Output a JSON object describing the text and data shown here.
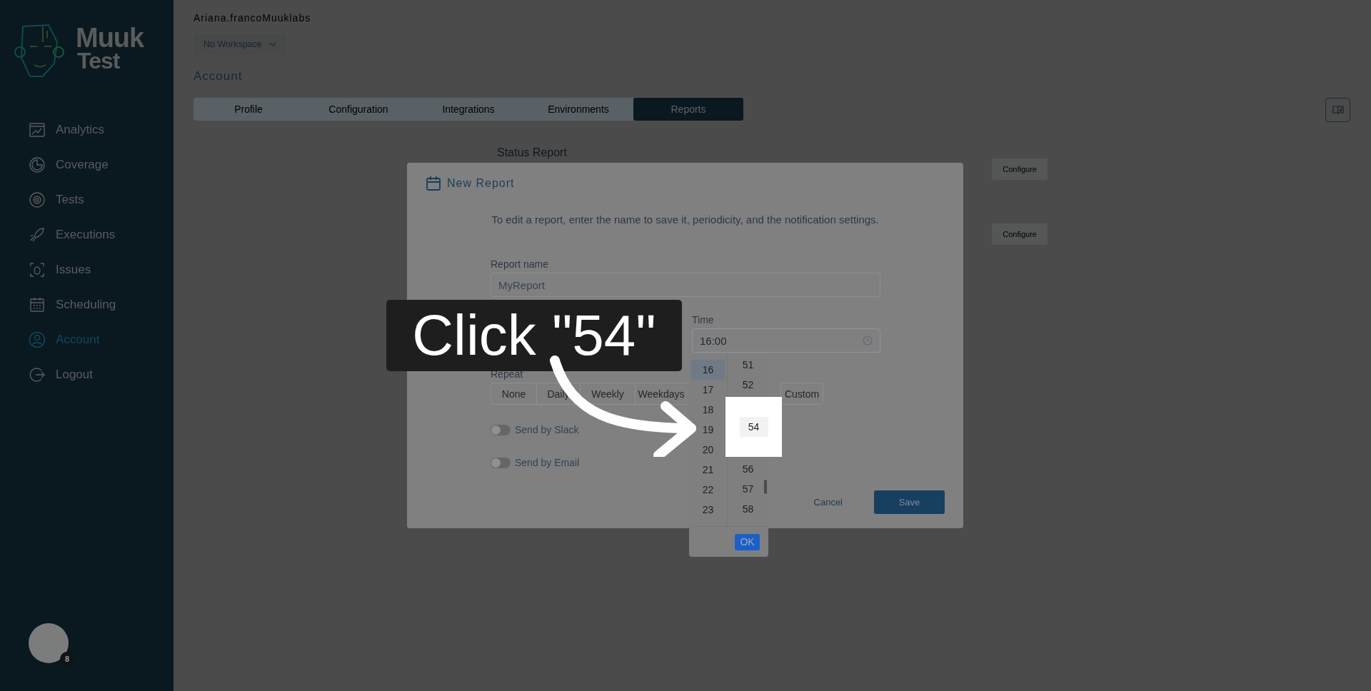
{
  "sidebar": {
    "logo": {
      "line_1": "Muuk",
      "line_2": "Test"
    },
    "items": [
      {
        "label": "Analytics",
        "selected": false
      },
      {
        "label": "Coverage",
        "selected": false
      },
      {
        "label": "Tests",
        "selected": false
      },
      {
        "label": "Executions",
        "selected": false
      },
      {
        "label": "Issues",
        "selected": false
      },
      {
        "label": "Scheduling",
        "selected": false
      },
      {
        "label": "Account",
        "selected": true
      },
      {
        "label": "Logout",
        "selected": false
      }
    ],
    "avatar": {
      "badge": "8"
    }
  },
  "header": {
    "user": "Ariana.francoMuuklabs",
    "workspace": "No Workspace",
    "title": "Account"
  },
  "tabs": [
    {
      "label": "Profile",
      "selected": false
    },
    {
      "label": "Configuration",
      "selected": false
    },
    {
      "label": "Integrations",
      "selected": false
    },
    {
      "label": "Environments",
      "selected": false
    },
    {
      "label": "Reports",
      "selected": true
    }
  ],
  "reports": {
    "title": "Status Report",
    "buttons": [
      "Configure",
      "Configure"
    ]
  },
  "modal": {
    "title": "New Report",
    "description": "To edit a report, enter the name to save it, periodicity, and the notification settings.",
    "report_name": {
      "label": "Report name",
      "value": "MyReport"
    },
    "time": {
      "label": "Time",
      "value": "16:00"
    },
    "repeat": {
      "label": "Repeat",
      "options": [
        "None",
        "Daily",
        "Weekly",
        "Weekdays",
        "Custom"
      ]
    },
    "toggles": [
      {
        "label": "Send by Slack",
        "on": false
      },
      {
        "label": "Send by Email",
        "on": false
      }
    ],
    "cancel": "Cancel",
    "save": "Save"
  },
  "time_picker": {
    "hours": [
      {
        "label": "16",
        "selected": true
      },
      {
        "label": "17",
        "selected": false
      },
      {
        "label": "18",
        "selected": false
      },
      {
        "label": "19",
        "selected": false
      },
      {
        "label": "20",
        "selected": false
      },
      {
        "label": "21",
        "selected": false
      },
      {
        "label": "22",
        "selected": false
      },
      {
        "label": "23",
        "selected": false
      }
    ],
    "minutes_before": [
      "51",
      "52"
    ],
    "minute_highlighted": "54",
    "minutes_after": [
      "56",
      "57",
      "58"
    ],
    "ok": "OK"
  },
  "callout": {
    "text": "Click \"54\""
  }
}
